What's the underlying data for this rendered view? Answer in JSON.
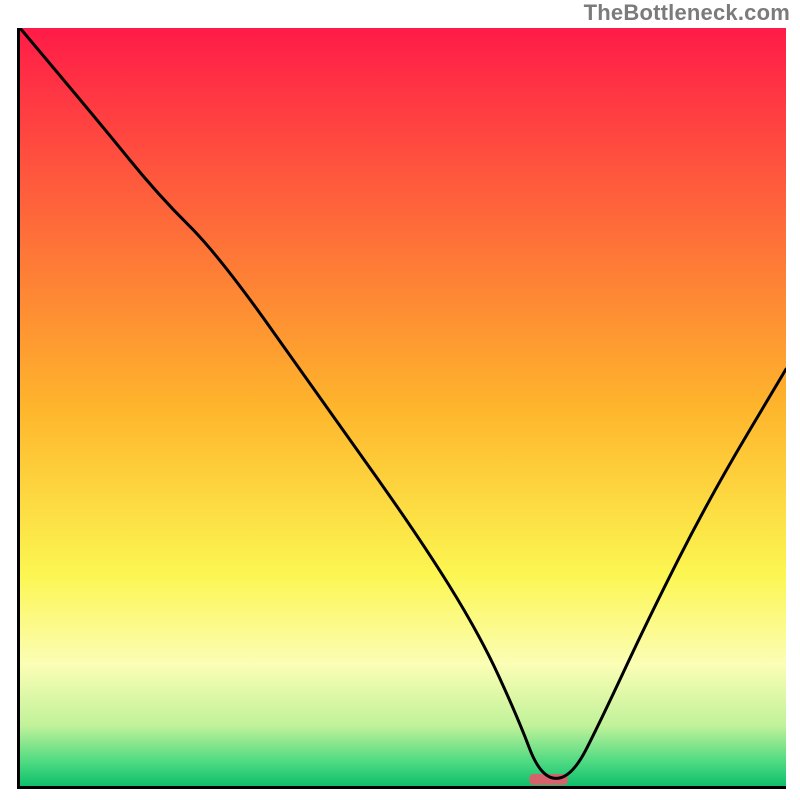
{
  "watermark": "TheBottleneck.com",
  "chart_data": {
    "type": "line",
    "title": "",
    "xlabel": "",
    "ylabel": "",
    "xlim": [
      0,
      100
    ],
    "ylim": [
      0,
      100
    ],
    "grid": false,
    "legend": false,
    "marker": {
      "x": 69,
      "width": 5,
      "color": "#d4636c"
    },
    "background_gradient": {
      "stops": [
        {
          "offset": 0,
          "color": "#ff1b48"
        },
        {
          "offset": 50,
          "color": "#feb52c"
        },
        {
          "offset": 72,
          "color": "#fcf651"
        },
        {
          "offset": 84,
          "color": "#fbfeb5"
        },
        {
          "offset": 92,
          "color": "#c1f29a"
        },
        {
          "offset": 97,
          "color": "#4ad981"
        },
        {
          "offset": 100,
          "color": "#0fbf6b"
        }
      ]
    },
    "series": [
      {
        "name": "curve",
        "color": "#000000",
        "x": [
          0,
          10,
          18,
          26,
          40,
          52,
          60,
          65,
          68,
          72,
          76,
          82,
          90,
          100
        ],
        "y": [
          100,
          88,
          78,
          70,
          50,
          33,
          20,
          9,
          1,
          1,
          9,
          22,
          38,
          55
        ]
      }
    ]
  }
}
